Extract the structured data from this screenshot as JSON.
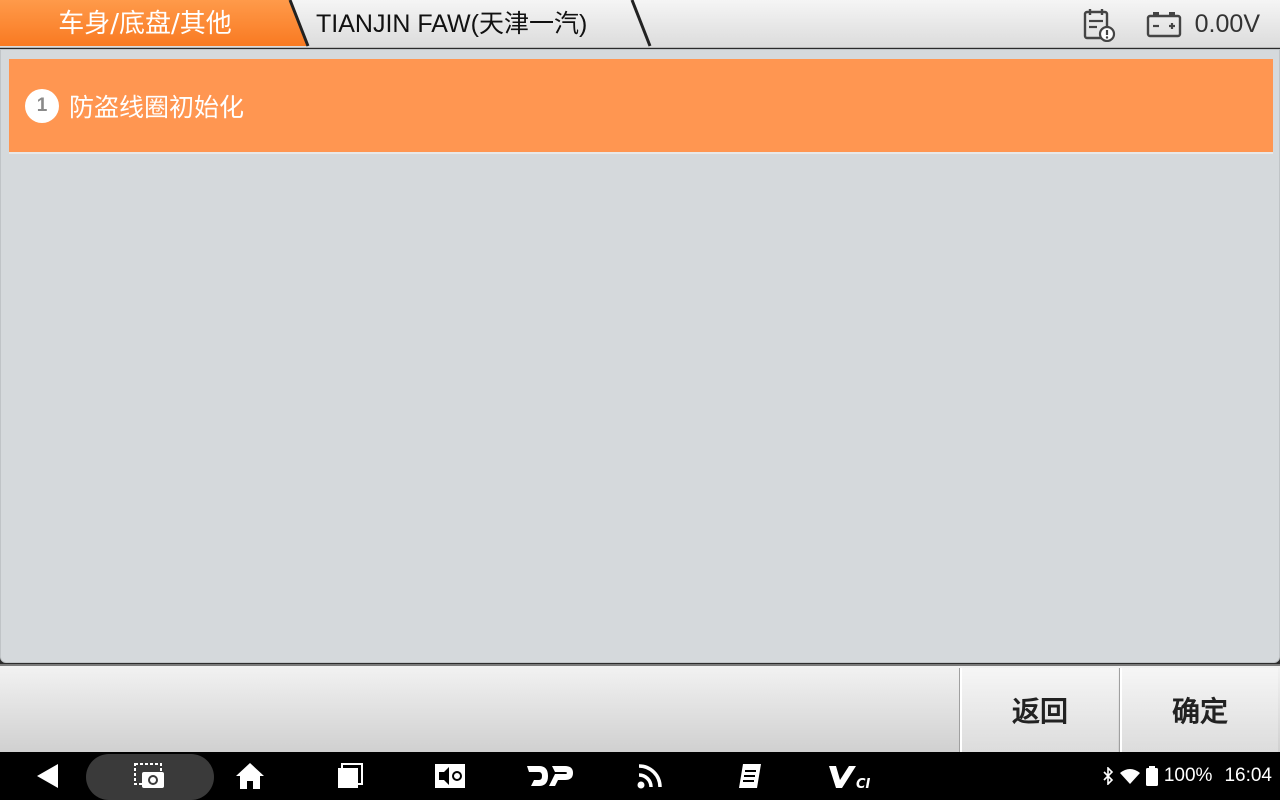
{
  "header": {
    "breadcrumb_active": "车身/底盘/其他",
    "breadcrumb_current": "TIANJIN FAW(天津一汽)",
    "voltage": "0.00V",
    "accent_color": "#ff8a3d"
  },
  "list": {
    "items": [
      {
        "number": "1",
        "label": "防盗线圈初始化",
        "selected": true
      }
    ]
  },
  "toolbar": {
    "back_label": "返回",
    "ok_label": "确定"
  },
  "status_bar": {
    "battery": "100%",
    "time": "16:04"
  },
  "icons": [
    "back-icon",
    "screenshot-icon",
    "home-icon",
    "recent-apps-icon",
    "brightness-icon",
    "dp-icon",
    "wifi-signal-icon",
    "notes-icon",
    "vci-icon",
    "bluetooth-icon",
    "wifi-icon",
    "battery-icon",
    "report-icon",
    "car-battery-icon"
  ]
}
